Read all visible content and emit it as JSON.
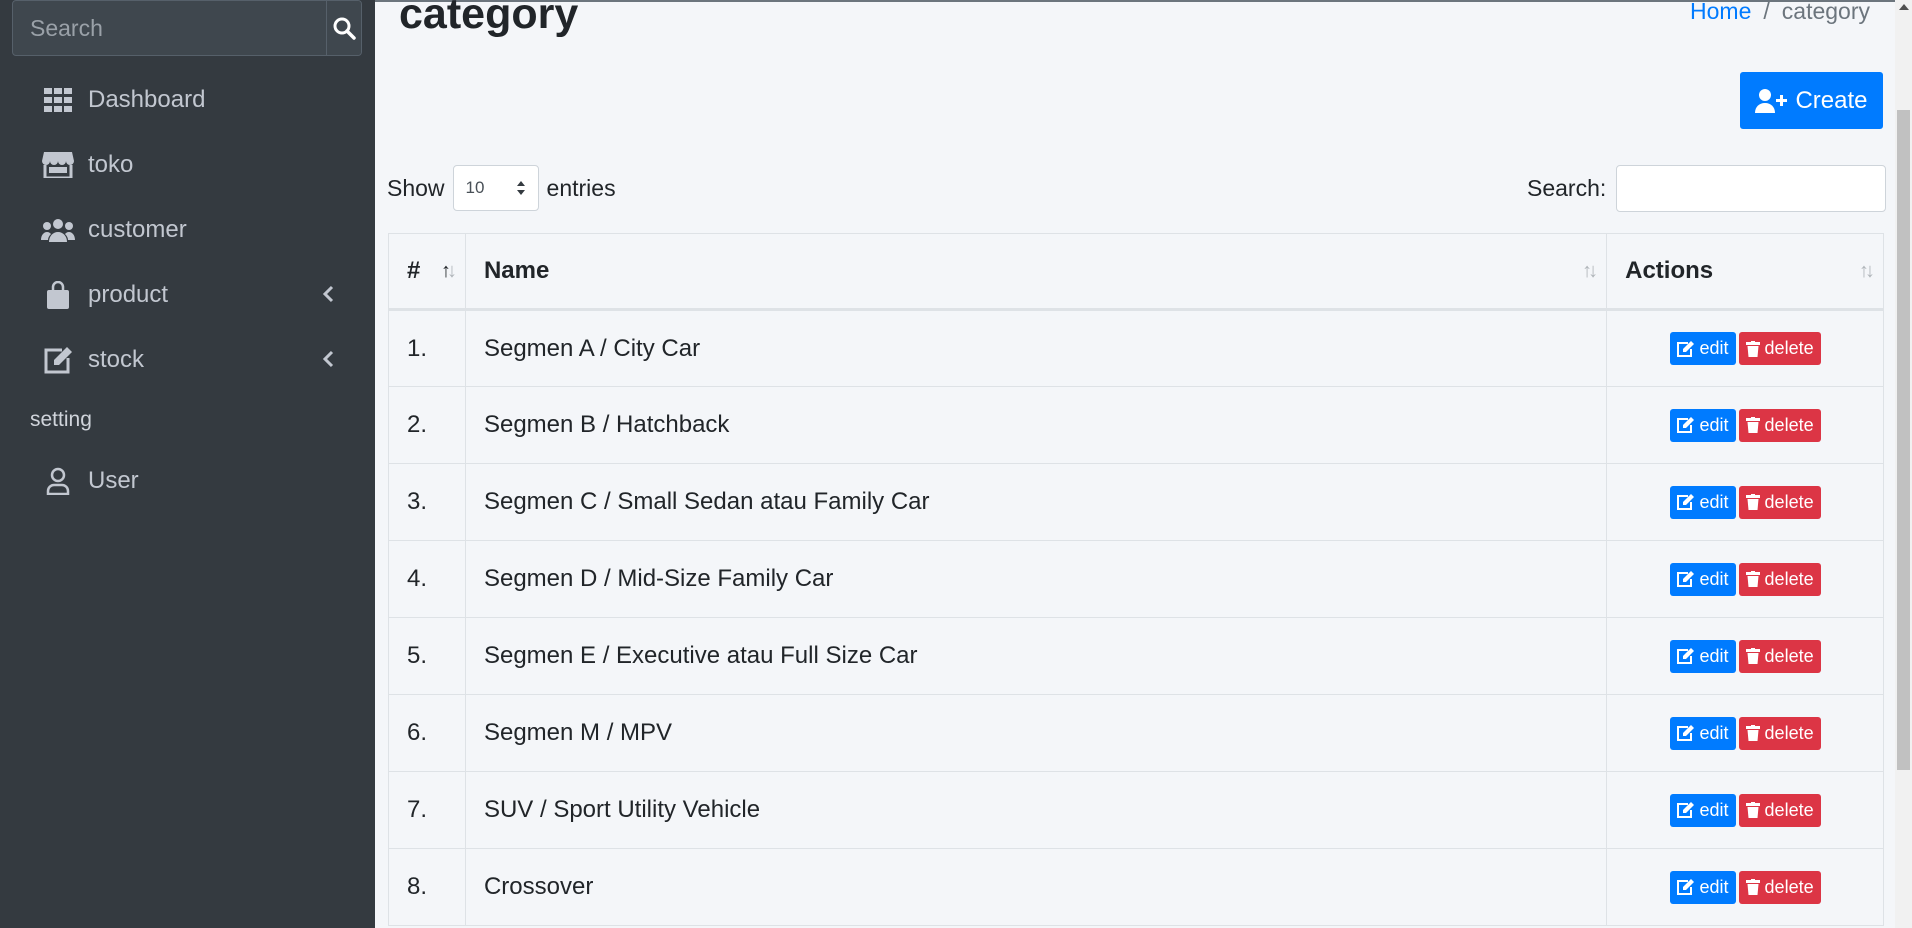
{
  "sidebar": {
    "search_placeholder": "Search",
    "items": [
      {
        "label": "Dashboard",
        "icon": "grid-icon"
      },
      {
        "label": "toko",
        "icon": "store-icon"
      },
      {
        "label": "customer",
        "icon": "users-icon"
      },
      {
        "label": "product",
        "icon": "shopping-bag-icon"
      },
      {
        "label": "stock",
        "icon": "edit-icon"
      }
    ],
    "section_header": "setting",
    "setting_items": [
      {
        "label": "User",
        "icon": "user-icon"
      }
    ]
  },
  "header": {
    "title": "category",
    "breadcrumb": {
      "home": "Home",
      "separator": "/",
      "current": "category"
    }
  },
  "toolbar": {
    "create_label": "Create"
  },
  "table_controls": {
    "show_label": "Show",
    "length_value": "10",
    "entries_label": "entries",
    "search_label": "Search:"
  },
  "table": {
    "columns": [
      "#",
      "Name",
      "Actions"
    ],
    "rows": [
      {
        "num": "1.",
        "name": "Segmen A / City Car"
      },
      {
        "num": "2.",
        "name": "Segmen B / Hatchback"
      },
      {
        "num": "3.",
        "name": "Segmen C / Small Sedan atau Family Car"
      },
      {
        "num": "4.",
        "name": "Segmen D / Mid-Size Family Car"
      },
      {
        "num": "5.",
        "name": "Segmen E / Executive atau Full Size Car"
      },
      {
        "num": "6.",
        "name": "Segmen M / MPV"
      },
      {
        "num": "7.",
        "name": "SUV / Sport Utility Vehicle"
      },
      {
        "num": "8.",
        "name": "Crossover"
      }
    ],
    "edit_label": "edit",
    "delete_label": "delete"
  },
  "colors": {
    "sidebar_bg": "#343a40",
    "primary": "#007bff",
    "danger": "#dc3545",
    "content_bg": "#f4f6f9"
  }
}
